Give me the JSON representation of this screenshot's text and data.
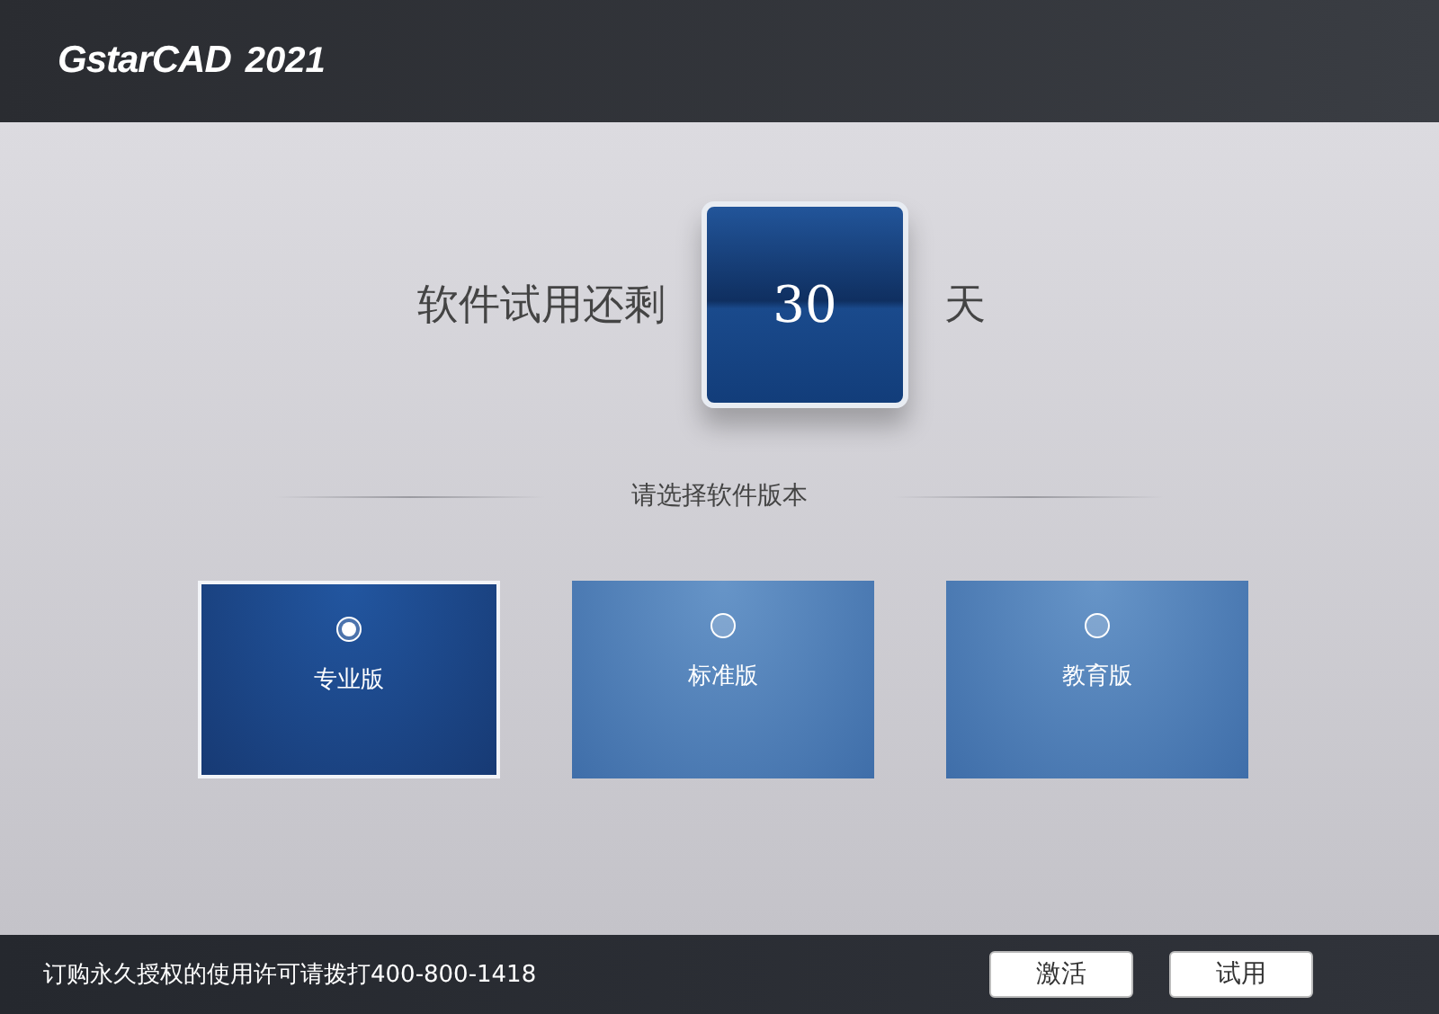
{
  "header": {
    "logo": "GstarCAD",
    "version": "2021"
  },
  "trial": {
    "prefix": "软件试用还剩",
    "days": "30",
    "suffix": "天"
  },
  "section_title": "请选择软件版本",
  "editions": [
    {
      "label": "专业版",
      "selected": true
    },
    {
      "label": "标准版",
      "selected": false
    },
    {
      "label": "教育版",
      "selected": false
    }
  ],
  "footer": {
    "notice": "订购永久授权的使用许可请拨打400-800-1418",
    "buttons": [
      "激活",
      "试用"
    ]
  }
}
